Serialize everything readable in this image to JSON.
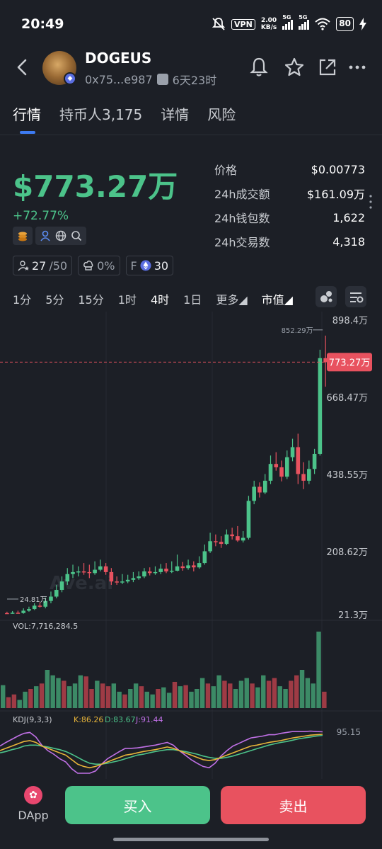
{
  "status": {
    "time": "20:49",
    "vpn": "VPN",
    "speed_top": "2.00",
    "speed_bottom": "KB/s",
    "sig1": "5G",
    "sig2": "5G",
    "battery": "80"
  },
  "header": {
    "name": "DOGEUS",
    "address": "0x75...e987",
    "age": "6天23时"
  },
  "tabs": [
    {
      "label": "行情"
    },
    {
      "label": "持币人3,175"
    },
    {
      "label": "详情"
    },
    {
      "label": "风险"
    }
  ],
  "summary": {
    "market_cap": "$773.27万",
    "change": "+72.77%"
  },
  "badges": {
    "holders_ratio": "27",
    "holders_total": "/50",
    "dev_pct": "0%",
    "f_label": "F",
    "f_value": "30"
  },
  "stats": [
    {
      "label": "价格",
      "value": "$0.00773"
    },
    {
      "label": "24h成交额",
      "value": "$161.09万"
    },
    {
      "label": "24h钱包数",
      "value": "1,622"
    },
    {
      "label": "24h交易数",
      "value": "4,318"
    }
  ],
  "intervals": [
    {
      "label": "1分"
    },
    {
      "label": "5分"
    },
    {
      "label": "15分"
    },
    {
      "label": "1时"
    },
    {
      "label": "4时"
    },
    {
      "label": "1日"
    },
    {
      "label": "更多◢"
    },
    {
      "label": "市值◢"
    }
  ],
  "colors": {
    "up": "#4cc38a",
    "down": "#e8525f",
    "accent": "#3d7bf2",
    "bg": "#1c1f26"
  },
  "chart_data": {
    "type": "candlestick",
    "y_unit": "万",
    "y_ticks": [
      "898.4万",
      "668.47万",
      "438.55万",
      "208.62万",
      "21.3万"
    ],
    "current_label": "773.27万",
    "high_label": "852.29万",
    "low_label": "24.81万",
    "watermark": "Ave.ai",
    "candles": [
      [
        26,
        25,
        30,
        24
      ],
      [
        25,
        27,
        32,
        24
      ],
      [
        27,
        26,
        33,
        25
      ],
      [
        26,
        33,
        40,
        24
      ],
      [
        33,
        38,
        45,
        30
      ],
      [
        38,
        48,
        55,
        35
      ],
      [
        48,
        45,
        58,
        42
      ],
      [
        45,
        62,
        72,
        40
      ],
      [
        62,
        75,
        90,
        55
      ],
      [
        75,
        95,
        110,
        70
      ],
      [
        95,
        120,
        135,
        88
      ],
      [
        120,
        142,
        160,
        110
      ],
      [
        142,
        148,
        170,
        130
      ],
      [
        148,
        150,
        165,
        135
      ],
      [
        150,
        148,
        175,
        140
      ],
      [
        148,
        145,
        170,
        130
      ],
      [
        145,
        155,
        180,
        140
      ],
      [
        155,
        165,
        185,
        150
      ],
      [
        165,
        148,
        175,
        140
      ],
      [
        148,
        120,
        160,
        110
      ],
      [
        120,
        118,
        135,
        110
      ],
      [
        118,
        120,
        142,
        112
      ],
      [
        120,
        125,
        140,
        115
      ],
      [
        125,
        130,
        148,
        118
      ],
      [
        130,
        135,
        150,
        125
      ],
      [
        135,
        150,
        160,
        130
      ],
      [
        150,
        145,
        162,
        138
      ],
      [
        145,
        148,
        165,
        140
      ],
      [
        148,
        158,
        172,
        142
      ],
      [
        158,
        150,
        175,
        145
      ],
      [
        150,
        152,
        180,
        145
      ],
      [
        152,
        165,
        200,
        150
      ],
      [
        165,
        160,
        178,
        152
      ],
      [
        160,
        168,
        185,
        155
      ],
      [
        168,
        162,
        180,
        150
      ],
      [
        162,
        175,
        195,
        158
      ],
      [
        175,
        210,
        230,
        170
      ],
      [
        210,
        240,
        265,
        205
      ],
      [
        240,
        238,
        260,
        225
      ],
      [
        238,
        232,
        255,
        220
      ],
      [
        232,
        260,
        275,
        228
      ],
      [
        260,
        255,
        280,
        245
      ],
      [
        255,
        242,
        285,
        238
      ],
      [
        242,
        250,
        270,
        236
      ],
      [
        250,
        360,
        375,
        245
      ],
      [
        360,
        402,
        420,
        350
      ],
      [
        402,
        385,
        415,
        370
      ],
      [
        385,
        420,
        440,
        380
      ],
      [
        420,
        470,
        495,
        410
      ],
      [
        470,
        460,
        505,
        450
      ],
      [
        460,
        432,
        480,
        418
      ],
      [
        432,
        490,
        510,
        425
      ],
      [
        490,
        520,
        545,
        478
      ],
      [
        520,
        440,
        560,
        410
      ],
      [
        440,
        420,
        475,
        395
      ],
      [
        420,
        455,
        480,
        410
      ],
      [
        455,
        500,
        515,
        440
      ],
      [
        500,
        785,
        810,
        495
      ],
      [
        785,
        773,
        852,
        700
      ]
    ],
    "volume": {
      "label": "VOL:7,716,284.5",
      "values": [
        42,
        20,
        25,
        15,
        30,
        35,
        40,
        45,
        70,
        60,
        55,
        50,
        40,
        45,
        60,
        58,
        35,
        50,
        45,
        40,
        45,
        30,
        25,
        35,
        45,
        40,
        30,
        25,
        35,
        38,
        28,
        48,
        40,
        42,
        30,
        35,
        55,
        45,
        40,
        60,
        50,
        45,
        35,
        50,
        55,
        45,
        38,
        60,
        50,
        55,
        40,
        35,
        50,
        60,
        70,
        55,
        45,
        140,
        30
      ],
      "directions": [
        1,
        -1,
        -1,
        1,
        1,
        -1,
        1,
        -1,
        1,
        1,
        1,
        -1,
        1,
        1,
        1,
        -1,
        -1,
        1,
        -1,
        -1,
        1,
        1,
        -1,
        1,
        1,
        -1,
        1,
        1,
        -1,
        1,
        1,
        -1,
        1,
        -1,
        1,
        1,
        1,
        -1,
        1,
        1,
        -1,
        -1,
        1,
        1,
        1,
        -1,
        1,
        1,
        -1,
        -1,
        1,
        1,
        -1,
        -1,
        1,
        1,
        1,
        1,
        -1
      ]
    },
    "kdj": {
      "label": "KDJ(9,3,3)",
      "k_label": "K:86.26",
      "d_label": "D:83.67",
      "j_label": "J:91.44",
      "scale_label": "95.15",
      "k": [
        50,
        55,
        60,
        65,
        70,
        72,
        68,
        60,
        55,
        50,
        45,
        40,
        30,
        20,
        15,
        12,
        15,
        20,
        25,
        30,
        35,
        40,
        42,
        45,
        48,
        50,
        52,
        55,
        58,
        55,
        50,
        45,
        40,
        35,
        30,
        28,
        30,
        35,
        40,
        45,
        50,
        55,
        60,
        62,
        65,
        68,
        70,
        72,
        75,
        78,
        80,
        82,
        84,
        85,
        86
      ],
      "d": [
        45,
        48,
        52,
        55,
        60,
        62,
        62,
        60,
        58,
        55,
        52,
        48,
        42,
        35,
        28,
        22,
        20,
        20,
        22,
        25,
        28,
        32,
        36,
        40,
        42,
        45,
        48,
        50,
        52,
        52,
        50,
        48,
        45,
        42,
        38,
        35,
        33,
        33,
        35,
        38,
        42,
        46,
        50,
        54,
        58,
        62,
        65,
        68,
        70,
        73,
        76,
        78,
        80,
        82,
        83.67
      ],
      "j": [
        60,
        68,
        75,
        82,
        88,
        90,
        80,
        62,
        50,
        42,
        32,
        25,
        10,
        0,
        0,
        0,
        5,
        20,
        32,
        40,
        48,
        55,
        55,
        56,
        58,
        60,
        62,
        65,
        68,
        62,
        50,
        40,
        30,
        22,
        15,
        12,
        22,
        38,
        50,
        60,
        66,
        72,
        78,
        80,
        82,
        85,
        85,
        88,
        90,
        92,
        92,
        92,
        93,
        92,
        91.44
      ]
    }
  },
  "bottom": {
    "dapp": "DApp",
    "buy": "买入",
    "sell": "卖出"
  }
}
